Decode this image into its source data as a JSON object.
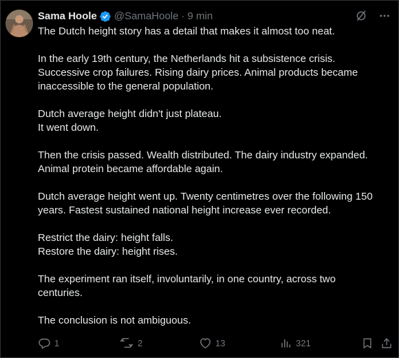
{
  "author": {
    "name": "Sama Hoole",
    "handle": "@SamaHoole",
    "separator": "·",
    "time": "9 min"
  },
  "icons": {
    "verified": "verified-badge-icon",
    "grok": "grok-icon",
    "more": "more-icon",
    "reply": "reply-icon",
    "retweet": "retweet-icon",
    "like": "like-icon",
    "views": "views-icon",
    "bookmark": "bookmark-icon",
    "share": "share-icon"
  },
  "colors": {
    "background": "#000000",
    "text": "#e7e9ea",
    "secondary": "#71767b",
    "verified": "#1d9bf0"
  },
  "tweet": {
    "paragraphs": [
      [
        "The Dutch height story has a detail that makes it almost too neat."
      ],
      [
        "In the early 19th century, the Netherlands hit a subsistence crisis.",
        "Successive crop failures. Rising dairy prices. Animal products became",
        "inaccessible to the general population."
      ],
      [
        "Dutch average height didn't just plateau.",
        "It went down."
      ],
      [
        "Then the crisis passed. Wealth distributed. The dairy industry expanded.",
        "Animal protein became affordable again."
      ],
      [
        "Dutch average height went up. Twenty centimetres over the following 150",
        "years. Fastest sustained national height increase ever recorded."
      ],
      [
        "Restrict the dairy: height falls.",
        "Restore the dairy: height rises."
      ],
      [
        "The experiment ran itself, involuntarily, in one country, across two",
        "centuries."
      ],
      [
        "The conclusion is not ambiguous."
      ]
    ]
  },
  "metrics": {
    "replies": "1",
    "retweets": "2",
    "likes": "13",
    "views": "321"
  }
}
